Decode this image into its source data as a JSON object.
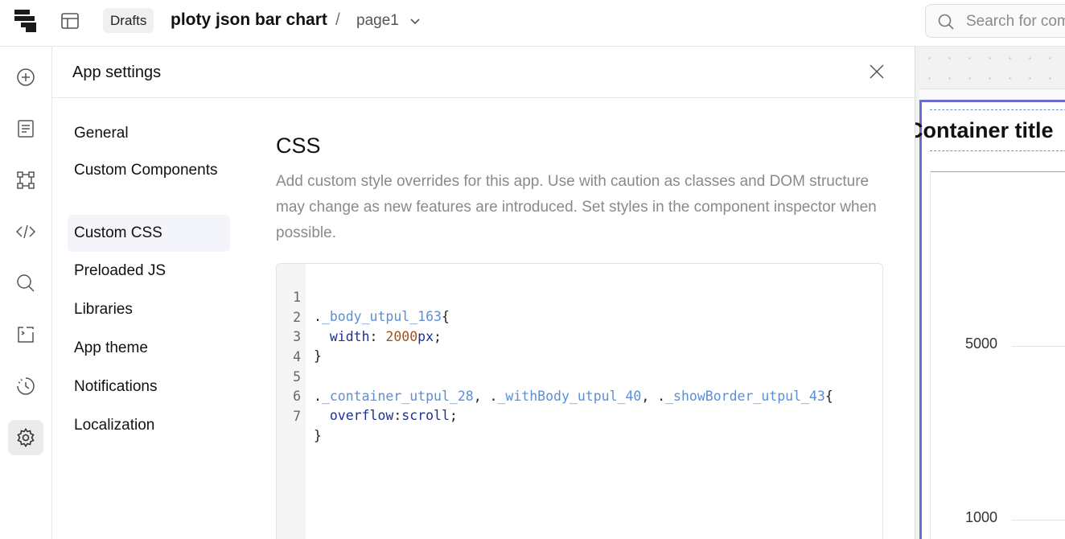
{
  "topbar": {
    "drafts_label": "Drafts",
    "app_title": "ploty json bar chart",
    "separator": "/",
    "page_name": "page1",
    "search_placeholder": "Search for commands"
  },
  "rail": {
    "items": [
      "add-icon",
      "pages-icon",
      "components-icon",
      "code-icon",
      "search-icon",
      "debug-icon",
      "history-icon",
      "settings-icon"
    ],
    "active": "settings-icon"
  },
  "panel": {
    "title": "App settings",
    "nav": [
      {
        "label": "General"
      },
      {
        "label": "Custom Components"
      },
      {
        "label": "Custom CSS"
      },
      {
        "label": "Preloaded JS"
      },
      {
        "label": "Libraries"
      },
      {
        "label": "App theme"
      },
      {
        "label": "Notifications"
      },
      {
        "label": "Localization"
      }
    ],
    "active_nav": "Custom CSS",
    "content": {
      "title": "CSS",
      "description": "Add custom style overrides for this app. Use with caution as classes and DOM structure may change as new features are introduced. Set styles in the component inspector when possible."
    },
    "editor": {
      "line_numbers": [
        "1",
        "2",
        "3",
        "4",
        "5",
        "6",
        "7"
      ],
      "lines": [
        "._body_utpul_163{",
        "  width: 2000px;",
        "}",
        "",
        "._container_utpul_28, ._withBody_utpul_40, ._showBorder_utpul_43{",
        "  overflow:scroll;",
        "}"
      ],
      "tokens": {
        "l1_dot": ".",
        "l1_cls": "_body_utpul_163",
        "l1_brace": "{",
        "l2_indent": "  ",
        "l2_prop": "width",
        "l2_colon": ": ",
        "l2_num": "2000",
        "l2_unit": "px",
        "l2_semi": ";",
        "l3": "}",
        "l5_dot1": ".",
        "l5_cls1": "_container_utpul_28",
        "l5_sep1": ", .",
        "l5_cls2": "_withBody_utpul_40",
        "l5_sep2": ", .",
        "l5_cls3": "_showBorder_utpul_43",
        "l5_brace": "{",
        "l6_indent": "  ",
        "l6_prop": "overflow",
        "l6_colon": ":",
        "l6_val": "scroll",
        "l6_semi": ";",
        "l7": "}"
      }
    }
  },
  "canvas": {
    "container_title": "Container title",
    "y_ticks": [
      "5000",
      "1000"
    ]
  },
  "colors": {
    "accent": "#6b6bd6",
    "code_class": "#5a8fd8",
    "code_property": "#1a2fa0",
    "code_number": "#a3521c"
  }
}
